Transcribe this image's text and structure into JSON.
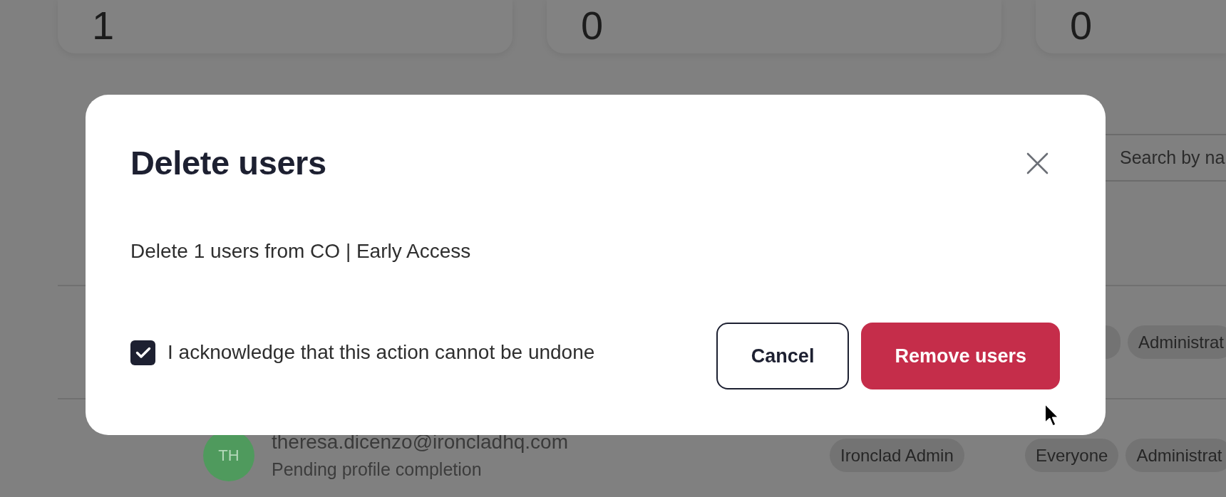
{
  "stat_cards": [
    {
      "value": "1"
    },
    {
      "value": "0"
    },
    {
      "value": "0"
    }
  ],
  "search": {
    "placeholder": "Search by na"
  },
  "user_rows": [
    {
      "groups": [
        {
          "covered": true
        },
        {
          "label": "Administrat",
          "covered": false
        }
      ]
    },
    {
      "initials": "TH",
      "email": "theresa.dicenzo@ironcladhq.com",
      "status": "Pending profile completion",
      "role": "Ironclad Admin",
      "groups": [
        {
          "label": "Everyone",
          "covered": false
        },
        {
          "label": "Administrat",
          "covered": false
        }
      ]
    }
  ],
  "dialog": {
    "title": "Delete users",
    "message": "Delete 1 users from CO | Early Access",
    "acknowledge": {
      "label": "I acknowledge that this action cannot be undone",
      "checked": true
    },
    "buttons": [
      {
        "label": "Cancel",
        "kind": "cancel"
      },
      {
        "label": "Remove users",
        "kind": "destructive"
      }
    ]
  }
}
